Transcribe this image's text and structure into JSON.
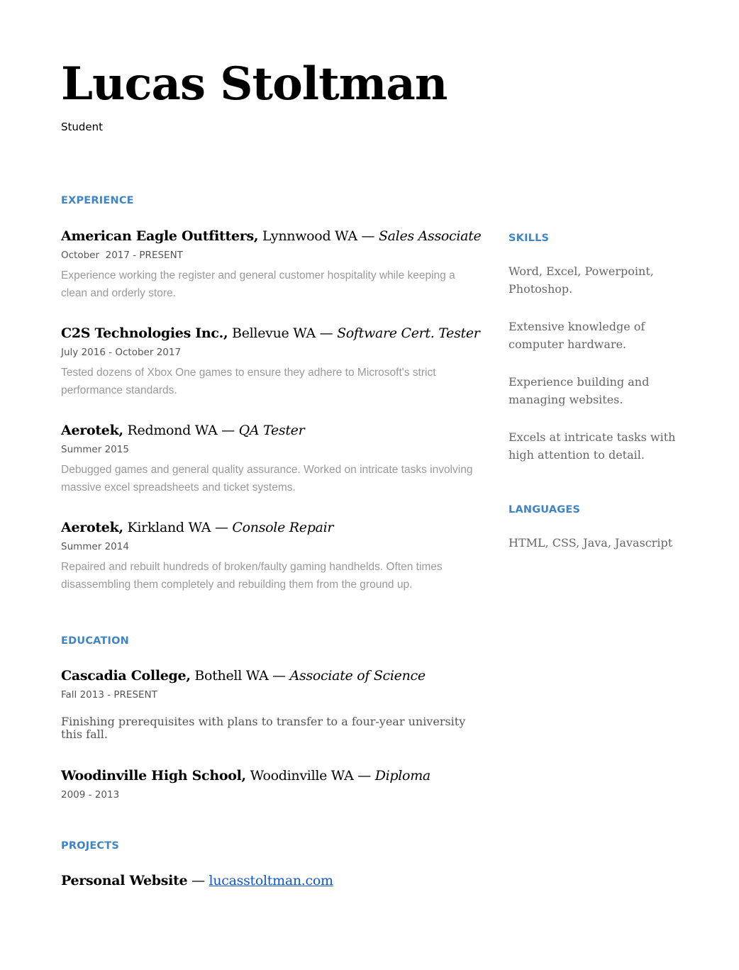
{
  "header": {
    "name": "Lucas Stoltman",
    "title": "Student"
  },
  "experience": {
    "heading": "EXPERIENCE",
    "items": [
      {
        "org": "American Eagle Outfitters,",
        "location": " Lynnwood WA — ",
        "role": "Sales Associate",
        "date": "October  2017 - PRESENT",
        "desc": "Experience working the register and general customer hospitality while keeping a clean and orderly store."
      },
      {
        "org": "C2S Technologies Inc.,",
        "location": " Bellevue WA — ",
        "role": "Software Cert. Tester",
        "date": "July 2016 - October 2017",
        "desc": "Tested dozens of Xbox One games to ensure they adhere to Microsoft's strict performance standards."
      },
      {
        "org": "Aerotek,",
        "location": " Redmond WA — ",
        "role": "QA Tester",
        "date": "Summer 2015",
        "desc": "Debugged games and general quality assurance. Worked on intricate tasks involving massive excel spreadsheets and ticket systems."
      },
      {
        "org": "Aerotek,",
        "location": " Kirkland WA — ",
        "role": "Console Repair",
        "date": "Summer 2014",
        "desc": "Repaired and rebuilt hundreds of broken/faulty gaming handhelds. Often times disassembling them completely and rebuilding them from the ground up."
      }
    ]
  },
  "education": {
    "heading": "EDUCATION",
    "items": [
      {
        "org": "Cascadia College,",
        "location": " Bothell WA — ",
        "role": "Associate of Science",
        "date": "Fall 2013 - PRESENT",
        "desc": "Finishing prerequisites with plans to transfer to a four-year university this fall."
      },
      {
        "org": "Woodinville High School,",
        "location": " Woodinville WA — ",
        "role": "Diploma",
        "date": "2009 - 2013"
      }
    ]
  },
  "projects": {
    "heading": "PROJECTS",
    "items": [
      {
        "name": "Personal Website",
        "separator": " — ",
        "link": "lucasstoltman.com"
      }
    ]
  },
  "skills": {
    "heading": "SKILLS",
    "items": [
      "Word, Excel, Powerpoint, Photoshop.",
      "Extensive knowledge of computer hardware.",
      "Experience building  and managing websites.",
      "Excels at intricate tasks with high attention to detail."
    ]
  },
  "languages": {
    "heading": "LANGUAGES",
    "text": "HTML, CSS, Java, Javascript"
  }
}
